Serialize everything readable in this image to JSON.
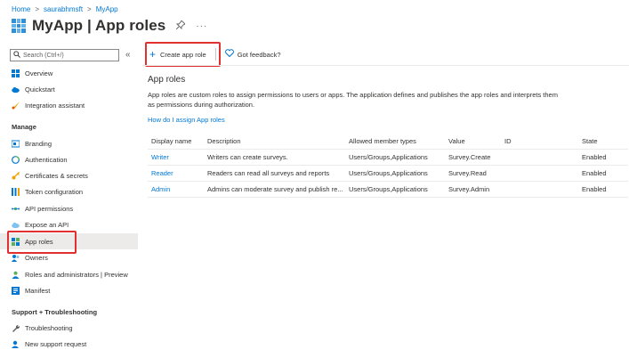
{
  "breadcrumb": {
    "items": [
      "Home",
      "saurabhmsft",
      "MyApp"
    ],
    "separator": ">"
  },
  "header": {
    "title": "MyApp | App roles",
    "pin_icon": "pin-icon",
    "more": "···"
  },
  "sidebar": {
    "search_placeholder": "Search (Ctrl+/)",
    "collapse": "«",
    "items_top": [
      {
        "label": "Overview",
        "icon": "grid-icon"
      },
      {
        "label": "Quickstart",
        "icon": "cloud-icon"
      },
      {
        "label": "Integration assistant",
        "icon": "rocket-icon"
      }
    ],
    "manage_header": "Manage",
    "manage_items": [
      {
        "label": "Branding",
        "icon": "branding-icon"
      },
      {
        "label": "Authentication",
        "icon": "auth-icon"
      },
      {
        "label": "Certificates & secrets",
        "icon": "key-icon"
      },
      {
        "label": "Token configuration",
        "icon": "token-icon"
      },
      {
        "label": "API permissions",
        "icon": "api-permissions-icon"
      },
      {
        "label": "Expose an API",
        "icon": "cloud-api-icon"
      },
      {
        "label": "App roles",
        "icon": "app-roles-icon",
        "active": true
      },
      {
        "label": "Owners",
        "icon": "owners-icon"
      },
      {
        "label": "Roles and administrators | Preview",
        "icon": "roles-admin-icon"
      },
      {
        "label": "Manifest",
        "icon": "manifest-icon"
      }
    ],
    "support_header": "Support + Troubleshooting",
    "support_items": [
      {
        "label": "Troubleshooting",
        "icon": "wrench-icon"
      },
      {
        "label": "New support request",
        "icon": "support-icon"
      }
    ]
  },
  "toolbar": {
    "create_label": "Create app role",
    "feedback_label": "Got feedback?"
  },
  "main": {
    "section_title": "App roles",
    "description": "App roles are custom roles to assign permissions to users or apps. The application defines and publishes the app roles and interprets them as permissions during authorization.",
    "help_link": "How do I assign App roles"
  },
  "table": {
    "columns": [
      "Display name",
      "Description",
      "Allowed member types",
      "Value",
      "ID",
      "State"
    ],
    "rows": [
      [
        "Writer",
        "Writers can create surveys.",
        "Users/Groups,Applications",
        "Survey.Create",
        "",
        "Enabled"
      ],
      [
        "Reader",
        "Readers can read all surveys and reports",
        "Users/Groups,Applications",
        "Survey.Read",
        "",
        "Enabled"
      ],
      [
        "Admin",
        "Admins can moderate survey and publish re...",
        "Users/Groups,Applications",
        "Survey.Admin",
        "",
        "Enabled"
      ]
    ]
  },
  "colors": {
    "accent": "#0078d4",
    "highlight": "#e03030",
    "active_bg": "#edebe9"
  }
}
